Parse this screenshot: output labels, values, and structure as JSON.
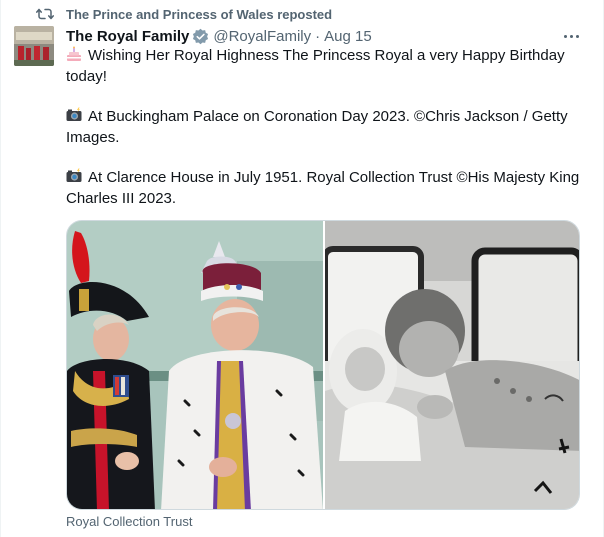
{
  "repost": {
    "icon": "repost-icon",
    "text": "The Prince and Princess of Wales reposted"
  },
  "tweet": {
    "author": {
      "display_name": "The Royal Family",
      "handle": "@RoyalFamily",
      "separator": "·",
      "date": "Aug 15",
      "verified_color": "#829aab"
    },
    "paragraphs": [
      {
        "emoji": "birthday-cake-icon",
        "text": "Wishing Her Royal Highness The Princess Royal a very Happy Birthday today!"
      },
      {
        "emoji": "camera-flash-icon",
        "text": "At Buckingham Palace on Coronation Day 2023. ©Chris Jackson / Getty Images."
      },
      {
        "emoji": "camera-flash-icon",
        "text": "At Clarence House in July 1951. Royal Collection Trust ©His Majesty King Charles III 2023."
      }
    ],
    "media": [
      {
        "name": "coronation-day-photo",
        "kind": "color photo"
      },
      {
        "name": "clarence-house-1951-photo",
        "kind": "black and white photo"
      }
    ],
    "caption": "Royal Collection Trust"
  },
  "colors": {
    "text_primary": "#0f1419",
    "text_secondary": "#536471",
    "border": "#cfd9de"
  }
}
